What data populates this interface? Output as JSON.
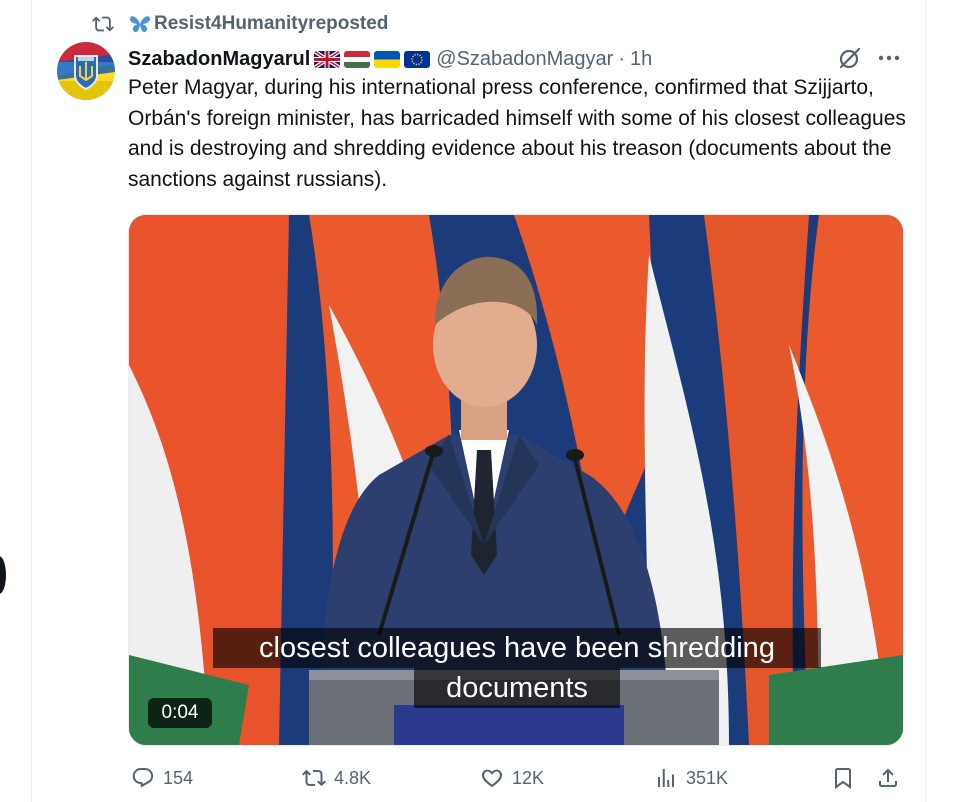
{
  "repost": {
    "icon": "repost-icon",
    "emoji_icon": "butterfly-icon",
    "user": "Resist4Humanity",
    "suffix": " reposted"
  },
  "tweet": {
    "display_name": "SzabadonMagyarul",
    "flags": [
      "uk-flag-icon",
      "hungary-flag-icon",
      "ukraine-flag-icon",
      "eu-flag-icon"
    ],
    "handle": "@SzabadonMagyar",
    "separator": "·",
    "time": "1h",
    "text": "Peter Magyar, during his international press conference, confirmed that Szijjarto, Orbán's foreign minister, has barricaded himself with some of his closest colleagues and is destroying and shredding evidence about his treason (documents about the sanctions against russians)."
  },
  "media": {
    "caption_line1": "closest colleagues have been shredding",
    "caption_line2": "documents",
    "timestamp": "0:04"
  },
  "actions": {
    "replies": "154",
    "reposts": "4.8K",
    "likes": "12K",
    "views": "351K"
  },
  "colors": {
    "text": "#0f1419",
    "secondary": "#536471",
    "border": "#eff3f4"
  }
}
